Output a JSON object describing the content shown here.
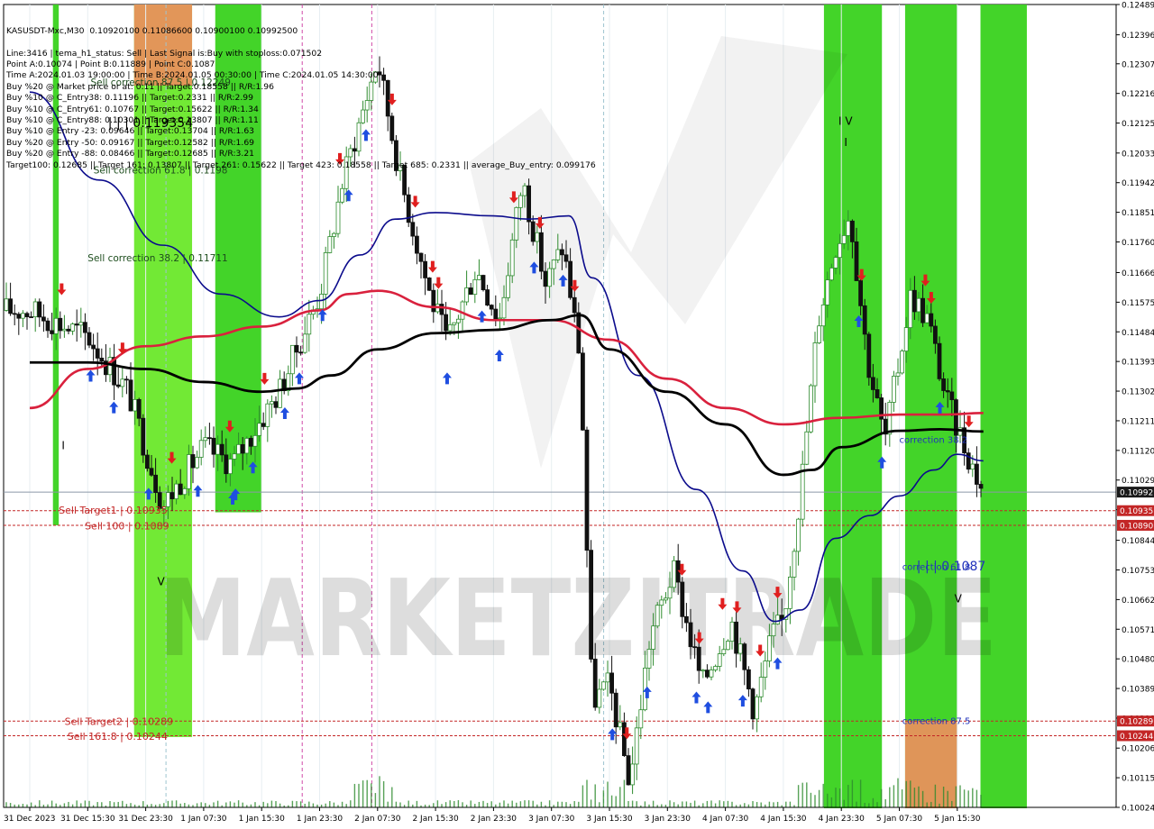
{
  "header": {
    "symbol_line": "KASUSDT-Mxc,M30  0.10920100 0.11086600 0.10900100 0.10992500",
    "info_lines": [
      "Line:3416 | tema_h1_status: Sell | Last Signal is:Buy with stoploss:0.071502",
      "Point A:0.10074 | Point B:0.11889 | Point C:0.1087",
      "Time A:2024.01.03 19:00:00 | Time B:2024.01.05 00:30:00 | Time C:2024.01.05 14:30:00",
      "Buy %20 @ Market price or at: 0.11 || Target:0.18558 || R/R:1.96",
      "Buy %10 @ C_Entry38: 0.11196 || Target:0.2331 || R/R:2.99",
      "Buy %10 @ C_Entry61: 0.10767 || Target:0.15622 || R/R:1.34",
      "Buy %10 @ C_Entry88: 0.10301 || Target:0.13807 || R/R:1.11",
      "Buy %10 @ Entry -23: 0.09646 || Target:0.13704 || R/R:1.63",
      "Buy %20 @ Entry -50: 0.09167 || Target:0.12582 || R/R:1.69",
      "Buy %20 @ Entry -88: 0.08466 || Target:0.12685 || R/R:3.21",
      "Target100: 0.12685 || Target 161: 0.13807 || Target 261: 0.15622 || Target 423: 0.18558 || Target 685: 0.2331 || average_Buy_entry: 0.099176"
    ]
  },
  "watermark": "MARKETZITRADE",
  "colors": {
    "zone_green": "#39d21d",
    "zone_light_green": "#6ae82a",
    "zone_orange": "#e8915c",
    "bull_candle": "#2e8b2e",
    "bear_candle": "#111111",
    "ma_blue": "#0b0b8c",
    "ma_red": "#d9213d",
    "ma_black": "#000000",
    "arrow_up": "#1f4ee0",
    "arrow_down": "#e01f1f",
    "sell_level": "#c32626",
    "correction_text": "#2233bb"
  },
  "chart_data": {
    "type": "candlestick",
    "symbol": "KASUSDT-Mxc",
    "timeframe": "M30",
    "ohlc_current": {
      "open": 0.109201,
      "high": 0.110866,
      "low": 0.109001,
      "close": 0.109925
    },
    "y_ticks": [
      "0.12489",
      "0.12396",
      "0.12307",
      "0.12216",
      "0.12125",
      "0.12033",
      "0.11942",
      "0.11851",
      "0.11760",
      "0.11666",
      "0.11575",
      "0.11484",
      "0.11393",
      "0.11302",
      "0.11211",
      "0.11120",
      "0.11029",
      "0.10938",
      "0.10844",
      "0.10753",
      "0.10662",
      "0.10571",
      "0.10480",
      "0.10389",
      "0.10298",
      "0.10206",
      "0.10115",
      "0.10024"
    ],
    "y_tick_values": [
      0.12489,
      0.12396,
      0.12307,
      0.12216,
      0.12125,
      0.12033,
      0.11942,
      0.11851,
      0.1176,
      0.11666,
      0.11575,
      0.11484,
      0.11393,
      0.11302,
      0.11211,
      0.1112,
      0.11029,
      0.10938,
      0.10844,
      0.10753,
      0.10662,
      0.10571,
      0.1048,
      0.10389,
      0.10298,
      0.10206,
      0.10115,
      0.10024
    ],
    "ylim": [
      0.10024,
      0.12489
    ],
    "x_ticks": [
      "31 Dec 2023",
      "31 Dec 15:30",
      "31 Dec 23:30",
      "1 Jan 07:30",
      "1 Jan 15:30",
      "1 Jan 23:30",
      "2 Jan 07:30",
      "2 Jan 15:30",
      "2 Jan 23:30",
      "3 Jan 07:30",
      "3 Jan 15:30",
      "3 Jan 23:30",
      "4 Jan 07:30",
      "4 Jan 15:30",
      "4 Jan 23:30",
      "5 Jan 07:30",
      "5 Jan 15:30"
    ],
    "price_labels": [
      {
        "text": "0.10992",
        "value": 0.10992,
        "style": "dark"
      },
      {
        "text": "0.10935",
        "value": 0.10935,
        "style": "red"
      },
      {
        "text": "0.10890",
        "value": 0.1089,
        "style": "red"
      },
      {
        "text": "0.10289",
        "value": 0.10289,
        "style": "red"
      },
      {
        "text": "0.10244",
        "value": 0.10244,
        "style": "red"
      }
    ],
    "levels": [
      {
        "value": 0.10992,
        "color": "#8c98a8",
        "dash": false
      },
      {
        "value": 0.10935,
        "color": "#c32626",
        "dash": true
      },
      {
        "value": 0.1089,
        "color": "#c32626",
        "dash": true
      },
      {
        "value": 0.10289,
        "color": "#c32626",
        "dash": true
      },
      {
        "value": 0.10244,
        "color": "#c32626",
        "dash": true
      }
    ],
    "zones": [
      {
        "from": 0.4,
        "to": 0.5,
        "top": 0.12489,
        "bottom": 0.1089,
        "color": "green"
      },
      {
        "from": 1.8,
        "to": 2.8,
        "top": 0.12489,
        "bottom": 0.1024,
        "color": "lightgreen"
      },
      {
        "from": 1.8,
        "to": 2.8,
        "top": 0.12489,
        "bottom": 0.1224,
        "color": "orange"
      },
      {
        "from": 3.2,
        "to": 4.0,
        "top": 0.12489,
        "bottom": 0.1093,
        "color": "green"
      },
      {
        "from": 13.7,
        "to": 14.7,
        "top": 0.12489,
        "bottom": 0.1002,
        "color": "green"
      },
      {
        "from": 15.1,
        "to": 16.0,
        "top": 0.12489,
        "bottom": 0.1002,
        "color": "green"
      },
      {
        "from": 15.1,
        "to": 16.0,
        "top": 0.1029,
        "bottom": 0.1002,
        "color": "orange"
      },
      {
        "from": 16.4,
        "to": 17.2,
        "top": 0.12489,
        "bottom": 0.1002,
        "color": "green"
      }
    ],
    "annotations": [
      {
        "text": "Sell correction 87.5 | 0.12249",
        "x": 1.05,
        "price": 0.1224,
        "color": "#1d4d1d",
        "size": 10.5
      },
      {
        "text": "| | | 0.119354",
        "x": 1.35,
        "price": 0.12113,
        "color": "#000000",
        "size": 14
      },
      {
        "text": "Sell correction 61.8 | 0.1198",
        "x": 1.1,
        "price": 0.1197,
        "color": "#1d4d1d",
        "size": 10.5
      },
      {
        "text": "Sell correction 38.2 | 0.11711",
        "x": 1.0,
        "price": 0.117,
        "color": "#1d4d1d",
        "size": 10.5
      },
      {
        "text": "I",
        "x": 0.55,
        "price": 0.11124,
        "color": "#000000",
        "size": 12
      },
      {
        "text": "Sell Target1 | 0.10935",
        "x": 0.5,
        "price": 0.10926,
        "color": "#c32626",
        "size": 11
      },
      {
        "text": "Sell 100 | 0.1089",
        "x": 0.95,
        "price": 0.10878,
        "color": "#c32626",
        "size": 11
      },
      {
        "text": "Sell Target2 | 0.10289",
        "x": 0.6,
        "price": 0.10277,
        "color": "#c32626",
        "size": 11
      },
      {
        "text": "Sell 161.8 | 0.10244",
        "x": 0.65,
        "price": 0.10232,
        "color": "#c32626",
        "size": 11
      },
      {
        "text": "V",
        "x": 2.2,
        "price": 0.10706,
        "color": "#000000",
        "size": 12
      },
      {
        "text": "I V",
        "x": 13.95,
        "price": 0.1212,
        "color": "#000000",
        "size": 12
      },
      {
        "text": "I",
        "x": 14.05,
        "price": 0.12055,
        "color": "#000000",
        "size": 12
      },
      {
        "text": "correction 38.2",
        "x": 15.0,
        "price": 0.11143,
        "color": "#2233bb",
        "size": 10
      },
      {
        "text": "correction 61.8",
        "x": 15.05,
        "price": 0.10753,
        "color": "#2233bb",
        "size": 10
      },
      {
        "text": "| | | 0.1087",
        "x": 15.3,
        "price": 0.10752,
        "color": "#2233bb",
        "size": 14
      },
      {
        "text": "V",
        "x": 15.95,
        "price": 0.10654,
        "color": "#000000",
        "size": 12
      },
      {
        "text": "correction 87.5",
        "x": 15.05,
        "price": 0.1028,
        "color": "#2233bb",
        "size": 10
      }
    ],
    "anchors": [
      {
        "x": 0,
        "price": 0.1155
      },
      {
        "x": 1.0,
        "price": 0.1147
      },
      {
        "x": 1.7,
        "price": 0.113
      },
      {
        "x": 2.3,
        "price": 0.1095
      },
      {
        "x": 3.0,
        "price": 0.1113
      },
      {
        "x": 3.5,
        "price": 0.1108
      },
      {
        "x": 4.3,
        "price": 0.113
      },
      {
        "x": 5.0,
        "price": 0.116
      },
      {
        "x": 5.4,
        "price": 0.1195
      },
      {
        "x": 6.0,
        "price": 0.1232
      },
      {
        "x": 6.4,
        "price": 0.1195
      },
      {
        "x": 6.9,
        "price": 0.116
      },
      {
        "x": 7.2,
        "price": 0.1145
      },
      {
        "x": 7.7,
        "price": 0.1168
      },
      {
        "x": 8.1,
        "price": 0.1152
      },
      {
        "x": 8.5,
        "price": 0.1195
      },
      {
        "x": 8.9,
        "price": 0.1163
      },
      {
        "x": 9.2,
        "price": 0.1175
      },
      {
        "x": 9.5,
        "price": 0.114
      },
      {
        "x": 9.7,
        "price": 0.1035
      },
      {
        "x": 10.0,
        "price": 0.104
      },
      {
        "x": 10.35,
        "price": 0.101
      },
      {
        "x": 10.7,
        "price": 0.1055
      },
      {
        "x": 11.1,
        "price": 0.1075
      },
      {
        "x": 11.6,
        "price": 0.104
      },
      {
        "x": 12.1,
        "price": 0.106
      },
      {
        "x": 12.5,
        "price": 0.1032
      },
      {
        "x": 12.8,
        "price": 0.1055
      },
      {
        "x": 13.0,
        "price": 0.106
      },
      {
        "x": 13.3,
        "price": 0.11
      },
      {
        "x": 13.6,
        "price": 0.1152
      },
      {
        "x": 13.9,
        "price": 0.1175
      },
      {
        "x": 14.15,
        "price": 0.1185
      },
      {
        "x": 14.45,
        "price": 0.114
      },
      {
        "x": 14.75,
        "price": 0.1115
      },
      {
        "x": 15.2,
        "price": 0.116
      },
      {
        "x": 15.5,
        "price": 0.1152
      },
      {
        "x": 15.8,
        "price": 0.1128
      },
      {
        "x": 16.2,
        "price": 0.111
      },
      {
        "x": 16.45,
        "price": 0.1099
      }
    ],
    "ma_blue": [
      {
        "x": 0,
        "price": 0.1222
      },
      {
        "x": 1.2,
        "price": 0.1195
      },
      {
        "x": 2.3,
        "price": 0.1175
      },
      {
        "x": 3.3,
        "price": 0.116
      },
      {
        "x": 4.3,
        "price": 0.1153
      },
      {
        "x": 5.0,
        "price": 0.1158
      },
      {
        "x": 5.7,
        "price": 0.1172
      },
      {
        "x": 6.3,
        "price": 0.1183
      },
      {
        "x": 7.0,
        "price": 0.1185
      },
      {
        "x": 8.0,
        "price": 0.1184
      },
      {
        "x": 8.6,
        "price": 0.1183
      },
      {
        "x": 9.3,
        "price": 0.1184
      },
      {
        "x": 9.7,
        "price": 0.1165
      },
      {
        "x": 10.5,
        "price": 0.1135
      },
      {
        "x": 11.5,
        "price": 0.11
      },
      {
        "x": 12.3,
        "price": 0.1075
      },
      {
        "x": 12.85,
        "price": 0.10595
      },
      {
        "x": 13.3,
        "price": 0.1063
      },
      {
        "x": 13.9,
        "price": 0.1085
      },
      {
        "x": 14.5,
        "price": 0.1092
      },
      {
        "x": 15.0,
        "price": 0.1098
      },
      {
        "x": 15.6,
        "price": 0.1106
      },
      {
        "x": 16.0,
        "price": 0.11108
      },
      {
        "x": 16.45,
        "price": 0.11088
      }
    ],
    "ma_red": [
      {
        "x": 0,
        "price": 0.1125
      },
      {
        "x": 1.0,
        "price": 0.1137
      },
      {
        "x": 2.0,
        "price": 0.1144
      },
      {
        "x": 3.0,
        "price": 0.1147
      },
      {
        "x": 4.0,
        "price": 0.115
      },
      {
        "x": 5.0,
        "price": 0.1155
      },
      {
        "x": 5.5,
        "price": 0.116
      },
      {
        "x": 6.0,
        "price": 0.1161
      },
      {
        "x": 7.0,
        "price": 0.1156
      },
      {
        "x": 8.0,
        "price": 0.1152
      },
      {
        "x": 9.0,
        "price": 0.1152
      },
      {
        "x": 10.0,
        "price": 0.1146
      },
      {
        "x": 11.0,
        "price": 0.1134
      },
      {
        "x": 12.0,
        "price": 0.1125
      },
      {
        "x": 13.0,
        "price": 0.112
      },
      {
        "x": 14.0,
        "price": 0.1122
      },
      {
        "x": 15.0,
        "price": 0.1123
      },
      {
        "x": 15.8,
        "price": 0.1123
      },
      {
        "x": 16.45,
        "price": 0.11235
      }
    ],
    "ma_black": [
      {
        "x": 0,
        "price": 0.1139
      },
      {
        "x": 1.0,
        "price": 0.1139
      },
      {
        "x": 2.0,
        "price": 0.1137
      },
      {
        "x": 3.0,
        "price": 0.1133
      },
      {
        "x": 4.0,
        "price": 0.113
      },
      {
        "x": 4.6,
        "price": 0.1131
      },
      {
        "x": 5.2,
        "price": 0.1135
      },
      {
        "x": 6.0,
        "price": 0.1143
      },
      {
        "x": 7.0,
        "price": 0.1148
      },
      {
        "x": 8.0,
        "price": 0.1149
      },
      {
        "x": 9.0,
        "price": 0.1152
      },
      {
        "x": 9.5,
        "price": 0.11535
      },
      {
        "x": 10.0,
        "price": 0.1143
      },
      {
        "x": 11.0,
        "price": 0.113
      },
      {
        "x": 12.0,
        "price": 0.112
      },
      {
        "x": 13.0,
        "price": 0.11045
      },
      {
        "x": 13.5,
        "price": 0.1106
      },
      {
        "x": 14.0,
        "price": 0.1113
      },
      {
        "x": 15.0,
        "price": 0.1118
      },
      {
        "x": 15.7,
        "price": 0.11185
      },
      {
        "x": 16.45,
        "price": 0.11178
      }
    ],
    "up_arrows": [
      1.05,
      1.45,
      2.05,
      2.9,
      3.5,
      3.55,
      3.85,
      4.4,
      4.65,
      5.05,
      5.5,
      5.8,
      7.2,
      7.8,
      8.1,
      8.7,
      9.2,
      10.05,
      10.65,
      11.5,
      11.7,
      12.3,
      12.9,
      14.3,
      14.7,
      15.7
    ],
    "down_arrows": [
      0.55,
      1.6,
      2.45,
      3.45,
      4.05,
      5.35,
      6.25,
      6.65,
      6.95,
      7.05,
      8.35,
      8.8,
      9.4,
      10.3,
      11.25,
      11.55,
      11.95,
      12.2,
      12.6,
      12.9,
      14.35,
      15.45,
      15.55,
      16.2
    ]
  }
}
